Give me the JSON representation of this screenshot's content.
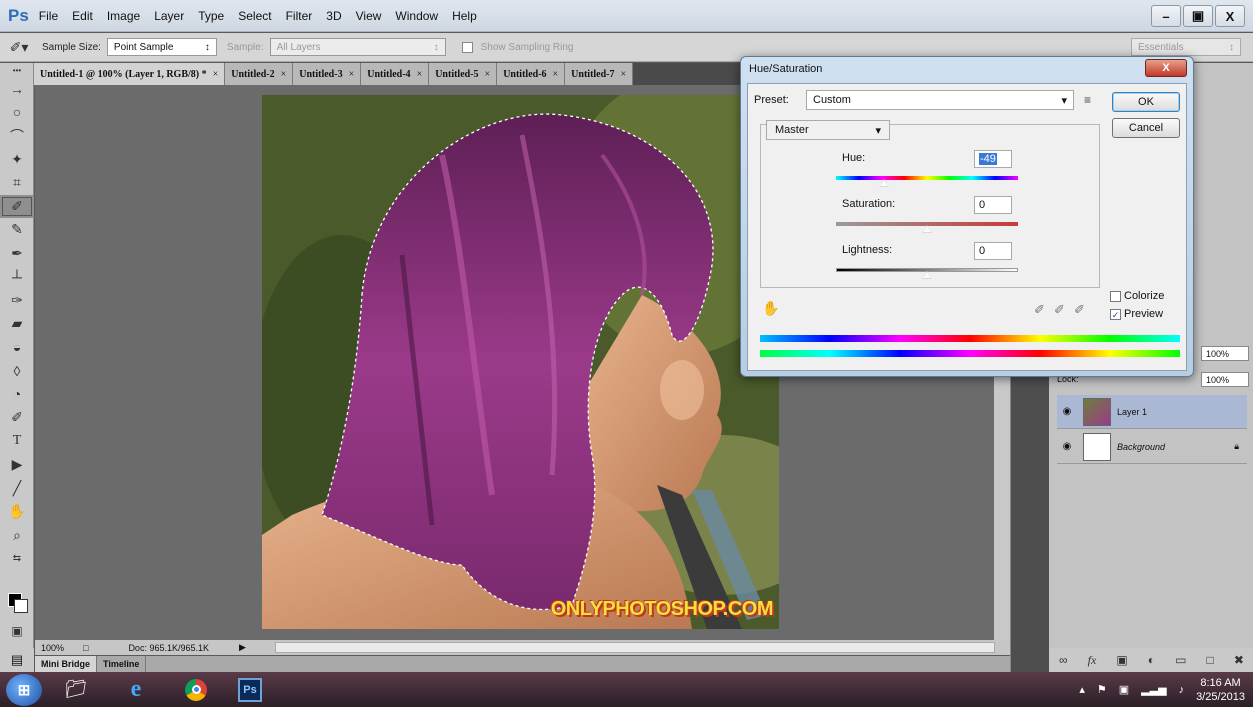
{
  "menubar": {
    "logo": "Ps",
    "items": [
      "File",
      "Edit",
      "Image",
      "Layer",
      "Type",
      "Select",
      "Filter",
      "3D",
      "View",
      "Window",
      "Help"
    ],
    "window_buttons": [
      "–",
      "▣",
      "X"
    ]
  },
  "options_bar": {
    "sample_size_label": "Sample Size:",
    "sample_size_value": "Point Sample",
    "sample_label": "Sample:",
    "sample_value": "All Layers",
    "sampling_ring_label": "Show Sampling Ring",
    "workspace_value": "Essentials"
  },
  "tabs": [
    {
      "label": "Untitled-1 @ 100% (Layer 1, RGB/8) *",
      "active": true
    },
    {
      "label": "Untitled-2",
      "active": false
    },
    {
      "label": "Untitled-3",
      "active": false
    },
    {
      "label": "Untitled-4",
      "active": false
    },
    {
      "label": "Untitled-5",
      "active": false
    },
    {
      "label": "Untitled-6",
      "active": false
    },
    {
      "label": "Untitled-7",
      "active": false
    }
  ],
  "tab_close": "×",
  "canvas": {
    "watermark": "ONLYPHOTOSHOP.COM"
  },
  "status_bar": {
    "zoom": "100%",
    "doc_info": "Doc: 965.1K/965.1K"
  },
  "bottom_tabs": [
    "Mini Bridge",
    "Timeline"
  ],
  "layers_panel": {
    "opacity_value": "100%",
    "fill_value": "100%",
    "lock_label": "Lock:",
    "layers": [
      {
        "name": "Layer 1",
        "selected": true
      },
      {
        "name": "Background",
        "selected": false
      }
    ]
  },
  "dialog": {
    "title": "Hue/Saturation",
    "close_label": "X",
    "preset_label": "Preset:",
    "preset_value": "Custom",
    "ok_label": "OK",
    "cancel_label": "Cancel",
    "channel_value": "Master",
    "hue_label": "Hue:",
    "hue_value": "-49",
    "saturation_label": "Saturation:",
    "saturation_value": "0",
    "lightness_label": "Lightness:",
    "lightness_value": "0",
    "colorize_label": "Colorize",
    "colorize_checked": false,
    "preview_label": "Preview",
    "preview_checked": true
  },
  "taskbar": {
    "apps": [
      "start-button",
      "file-explorer-icon",
      "internet-explorer-icon",
      "chrome-icon",
      "photoshop-icon"
    ],
    "ps_label": "Ps",
    "time": "8:16 AM",
    "date": "3/25/2013"
  },
  "colors": {
    "menubar_bg": "#cfd8e2",
    "dialog_frame": "#b9cde2",
    "selected_layer": "#aab8d4",
    "hair_purple": "#8a2b7a",
    "watermark_yellow": "#f5e03a",
    "watermark_red": "#c2361c"
  }
}
